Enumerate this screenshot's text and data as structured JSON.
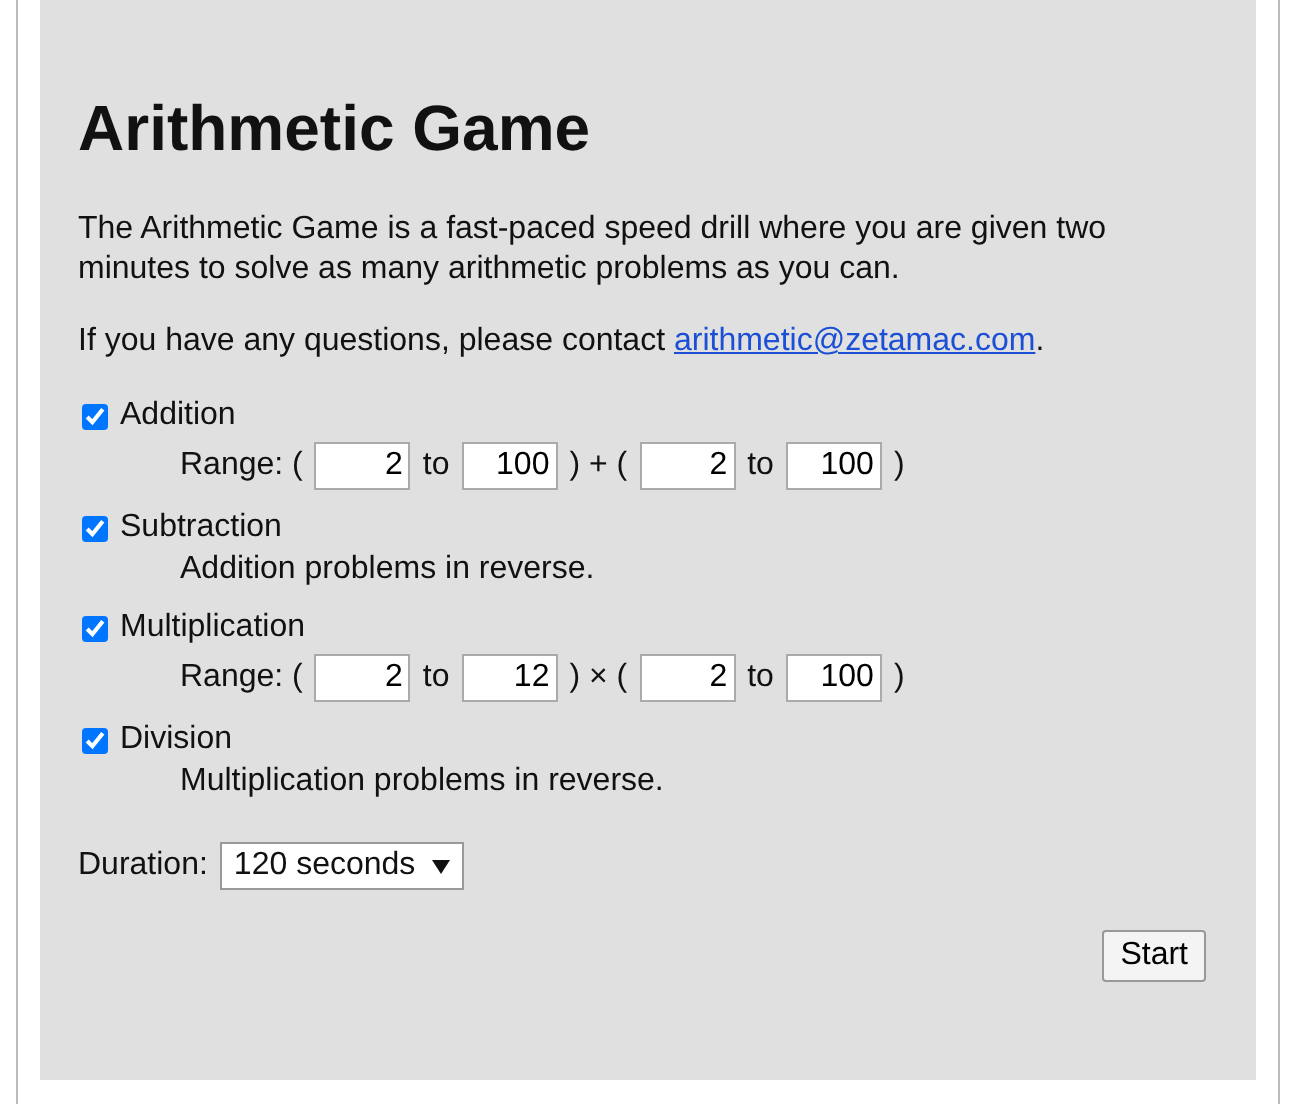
{
  "title": "Arithmetic Game",
  "intro": "The Arithmetic Game is a fast-paced speed drill where you are given two minutes to solve as many arithmetic problems as you can.",
  "contact": {
    "text": "If you have any questions, please contact ",
    "link": "arithmetic@zetamac.com",
    "end": "."
  },
  "operations": [
    {
      "kind": "range",
      "label": "Addition",
      "checked": true,
      "parts": [
        {
          "kind": "text",
          "text": "Range: ("
        },
        {
          "kind": "field",
          "value": "2"
        },
        {
          "kind": "text",
          "text": "to"
        },
        {
          "kind": "field",
          "value": "100"
        },
        {
          "kind": "text",
          "text": ") + ("
        },
        {
          "kind": "field",
          "value": "2"
        },
        {
          "kind": "text",
          "text": "to"
        },
        {
          "kind": "field",
          "value": "100"
        },
        {
          "kind": "text",
          "text": ")"
        }
      ]
    },
    {
      "kind": "note",
      "label": "Subtraction",
      "checked": true,
      "note": "Addition problems in reverse."
    },
    {
      "kind": "range",
      "label": "Multiplication",
      "checked": true,
      "parts": [
        {
          "kind": "text",
          "text": "Range: ("
        },
        {
          "kind": "field",
          "value": "2"
        },
        {
          "kind": "text",
          "text": "to"
        },
        {
          "kind": "field",
          "value": "12"
        },
        {
          "kind": "text",
          "text": ") × ("
        },
        {
          "kind": "field",
          "value": "2"
        },
        {
          "kind": "text",
          "text": "to"
        },
        {
          "kind": "field",
          "value": "100"
        },
        {
          "kind": "text",
          "text": ")"
        }
      ]
    },
    {
      "kind": "note",
      "label": "Division",
      "checked": true,
      "note": "Multiplication problems in reverse."
    }
  ],
  "duration": {
    "label": "Duration:",
    "value": "120 seconds"
  },
  "start_button": "Start"
}
